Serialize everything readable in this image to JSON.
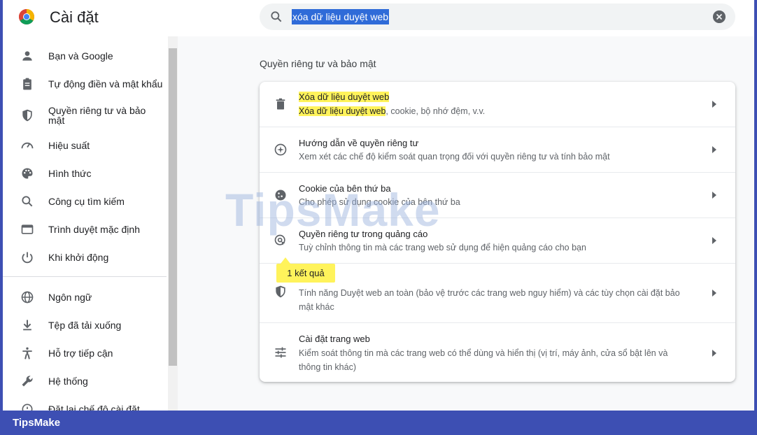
{
  "app": {
    "title": "Cài đặt"
  },
  "search": {
    "value": "xóa dữ liệu duyệt web"
  },
  "sidebar": {
    "items": [
      {
        "label": "Bạn và Google",
        "icon": "person-icon"
      },
      {
        "label": "Tự động điền và mật khẩu",
        "icon": "clipboard-icon"
      },
      {
        "label": "Quyền riêng tư và bảo mật",
        "icon": "shield-icon"
      },
      {
        "label": "Hiệu suất",
        "icon": "speedometer-icon"
      },
      {
        "label": "Hình thức",
        "icon": "palette-icon"
      },
      {
        "label": "Công cụ tìm kiếm",
        "icon": "search-icon"
      },
      {
        "label": "Trình duyệt mặc định",
        "icon": "browser-icon"
      },
      {
        "label": "Khi khởi động",
        "icon": "power-icon"
      },
      {
        "label": "Ngôn ngữ",
        "icon": "globe-icon"
      },
      {
        "label": "Tệp đã tải xuống",
        "icon": "download-icon"
      },
      {
        "label": "Hỗ trợ tiếp cận",
        "icon": "accessibility-icon"
      },
      {
        "label": "Hệ thống",
        "icon": "wrench-icon"
      },
      {
        "label": "Đặt lại chế độ cài đặt",
        "icon": "reset-icon"
      }
    ]
  },
  "main": {
    "section_title": "Quyền riêng tư và bảo mật",
    "rows": [
      {
        "title": "Xóa dữ liệu duyệt web",
        "desc_highlight": "Xóa dữ liệu duyệt web",
        "desc_rest": ", cookie, bộ nhớ đệm, v.v."
      },
      {
        "title": "Hướng dẫn về quyền riêng tư",
        "desc": "Xem xét các chế độ kiểm soát quan trọng đối với quyền riêng tư và tính bảo mật"
      },
      {
        "title": "Cookie của bên thứ ba",
        "desc": "Cho phép sử dụng cookie của bên thứ ba"
      },
      {
        "title": "Quyền riêng tư trong quảng cáo",
        "desc": "Tuỳ chỉnh thông tin mà các trang web sử dụng để hiện quảng cáo cho bạn"
      },
      {
        "desc": "Tính năng Duyệt web an toàn (bảo vệ trước các trang web nguy hiểm) và các tùy chọn cài đặt bảo mật khác"
      },
      {
        "title": "Cài đặt trang web",
        "desc": "Kiểm soát thông tin mà các trang web có thể dùng và hiển thị (vị trí, máy ảnh, cửa sổ bật lên và thông tin khác)"
      }
    ]
  },
  "tooltip": {
    "text": "1 kết quả"
  },
  "watermark": {
    "text": "TipsMake"
  },
  "brand": {
    "text": "TipsMake"
  },
  "colors": {
    "highlight": "#fff35b",
    "selection": "#2f6bd8",
    "frame": "#3d4fb3"
  }
}
